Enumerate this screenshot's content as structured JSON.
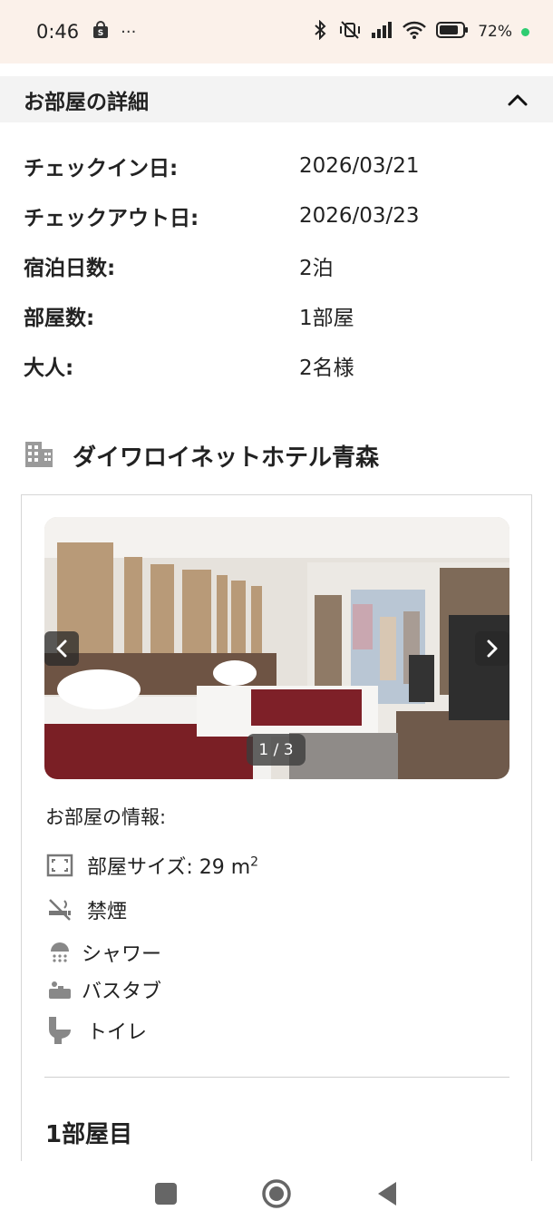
{
  "status_bar": {
    "time": "0:46",
    "more": "···",
    "battery": "72%"
  },
  "section": {
    "title": "お部屋の詳細"
  },
  "details": [
    {
      "label": "チェックイン日:",
      "value": "2026/03/21"
    },
    {
      "label": "チェックアウト日:",
      "value": "2026/03/23"
    },
    {
      "label": "宿泊日数:",
      "value": "2泊"
    },
    {
      "label": "部屋数:",
      "value": "1部屋"
    },
    {
      "label": "大人:",
      "value": "2名様"
    }
  ],
  "hotel": {
    "name": "ダイワロイネットホテル青森"
  },
  "carousel": {
    "pager": "1 / 3"
  },
  "room_info": {
    "title": "お部屋の情報:",
    "size_label": "部屋サイズ: 29 m",
    "size_sup": "2",
    "amenities": [
      "禁煙",
      "シャワー",
      "バスタブ",
      "トイレ"
    ]
  },
  "room_number": "1部屋目"
}
